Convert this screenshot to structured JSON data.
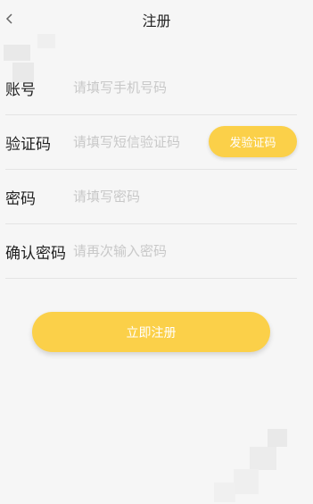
{
  "header": {
    "title": "注册",
    "back_icon": "chevron-left-icon"
  },
  "form": {
    "account": {
      "label": "账号",
      "placeholder": "请填写手机号码",
      "value": ""
    },
    "verification": {
      "label": "验证码",
      "placeholder": "请填写短信验证码",
      "value": "",
      "send_button": "发验证码"
    },
    "password": {
      "label": "密码",
      "placeholder": "请填写密码",
      "value": ""
    },
    "confirm_password": {
      "label": "确认密码",
      "placeholder": "请再次输入密码",
      "value": ""
    }
  },
  "actions": {
    "submit_label": "立即注册"
  },
  "colors": {
    "accent": "#fbd049",
    "background": "#f6f6f6",
    "divider": "#e4e4e4"
  }
}
